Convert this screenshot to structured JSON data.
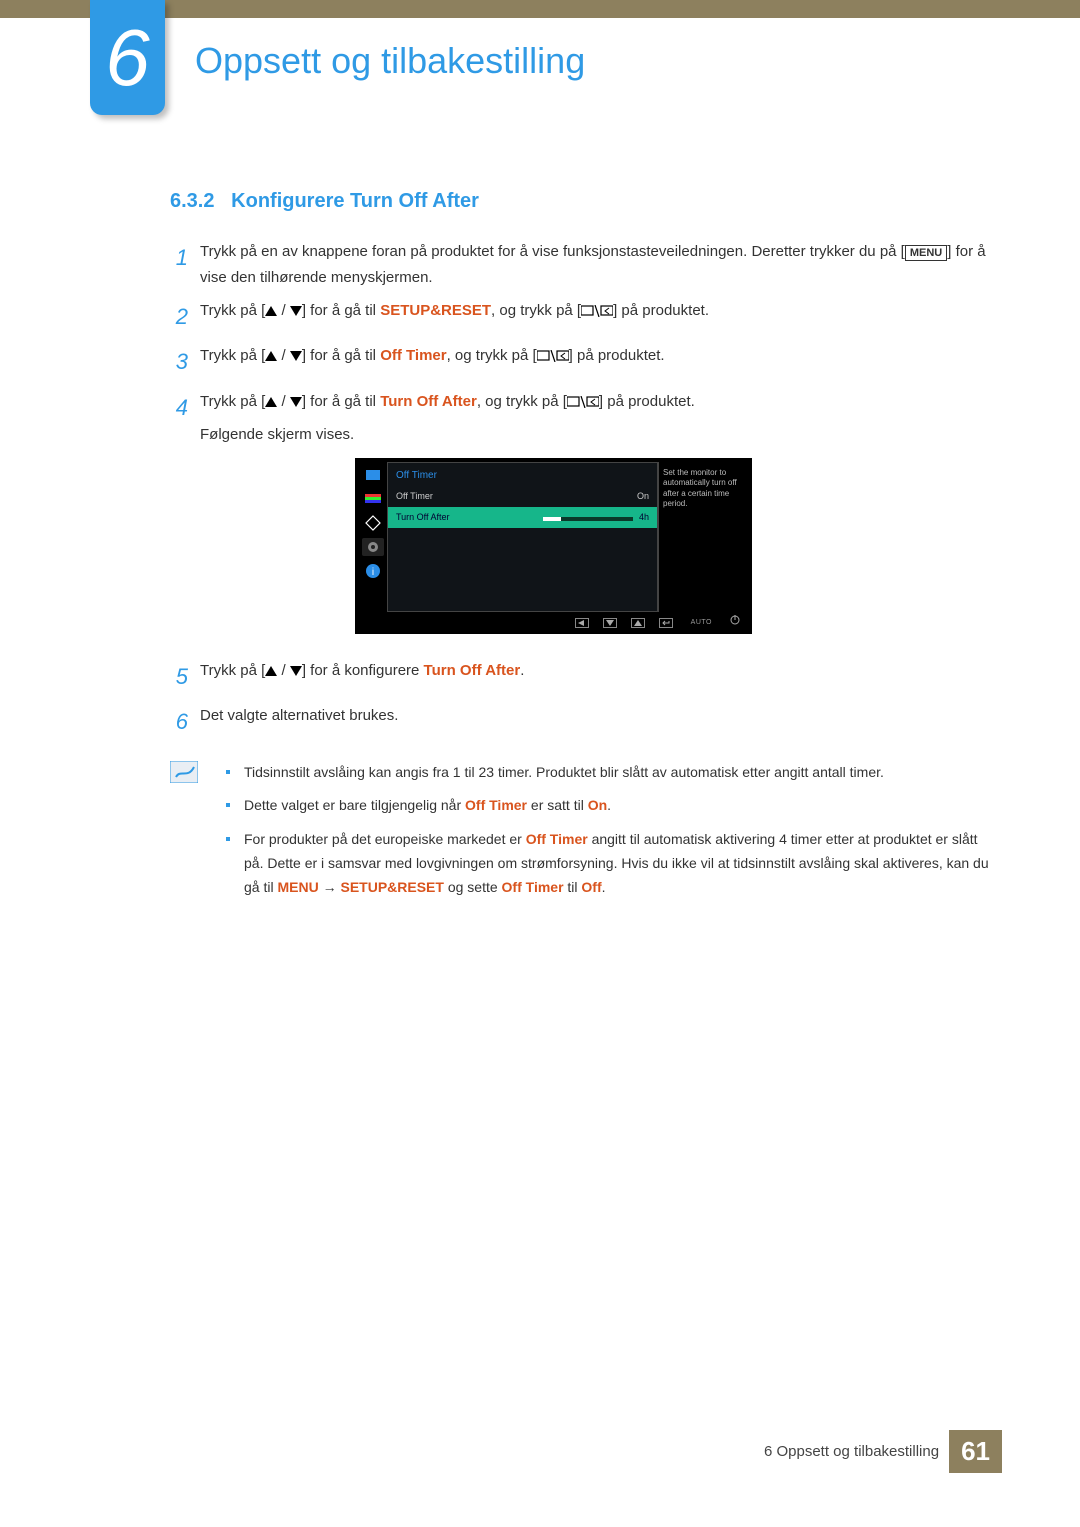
{
  "chapter": {
    "number": "6",
    "title": "Oppsett og tilbakestilling"
  },
  "section": {
    "number": "6.3.2",
    "title": "Konfigurere Turn Off After"
  },
  "steps": {
    "1": {
      "pre": "Trykk på en av knappene foran på produktet for å vise funksjonstasteveiledningen. Deretter trykker du på [",
      "menu": "MENU",
      "post": "] for å vise den tilhørende menyskjermen."
    },
    "2": {
      "pre": "Trykk på [",
      "mid1": "] for å gå til ",
      "kw": "SETUP&RESET",
      "mid2": ", og trykk på [",
      "post": "] på produktet."
    },
    "3": {
      "pre": "Trykk på [",
      "mid1": "] for å gå til ",
      "kw": "Off Timer",
      "mid2": ", og trykk på [",
      "post": "] på produktet."
    },
    "4": {
      "pre": "Trykk på [",
      "mid1": "] for å gå til ",
      "kw": "Turn Off After",
      "mid2": ", og trykk på [",
      "post": "] på produktet.",
      "follow": "Følgende skjerm vises."
    },
    "5": {
      "pre": "Trykk på [",
      "mid": "] for å konfigurere ",
      "kw": "Turn Off After",
      "post": "."
    },
    "6": {
      "text": "Det valgte alternativet brukes."
    }
  },
  "osd": {
    "title": "Off Timer",
    "row1_label": "Off Timer",
    "row1_value": "On",
    "row2_label": "Turn Off After",
    "row2_value": "4h",
    "help": "Set the monitor to automatically turn off after a certain time period.",
    "auto": "AUTO"
  },
  "notes": {
    "1": "Tidsinnstilt avslåing kan angis fra 1 til 23 timer. Produktet blir slått av automatisk etter angitt antall timer.",
    "2_a": "Dette valget er bare tilgjengelig når ",
    "2_b": "Off Timer",
    "2_c": " er satt til ",
    "2_d": "On",
    "2_e": ".",
    "3_a": "For produkter på det europeiske markedet er ",
    "3_b": "Off Timer",
    "3_c": " angitt til automatisk aktivering 4 timer etter at produktet er slått på. Dette er i samsvar med lovgivningen om strømforsyning. Hvis du ikke vil at tidsinnstilt avslåing skal aktiveres, kan du gå til ",
    "3_menu": "MENU",
    "3_arrow": " → ",
    "3_d": "SETUP&RESET",
    "3_e": " og sette ",
    "3_f": "Off Timer",
    "3_g": " til ",
    "3_h": "Off",
    "3_i": "."
  },
  "footer": {
    "text": "6 Oppsett og tilbakestilling",
    "page": "61"
  }
}
